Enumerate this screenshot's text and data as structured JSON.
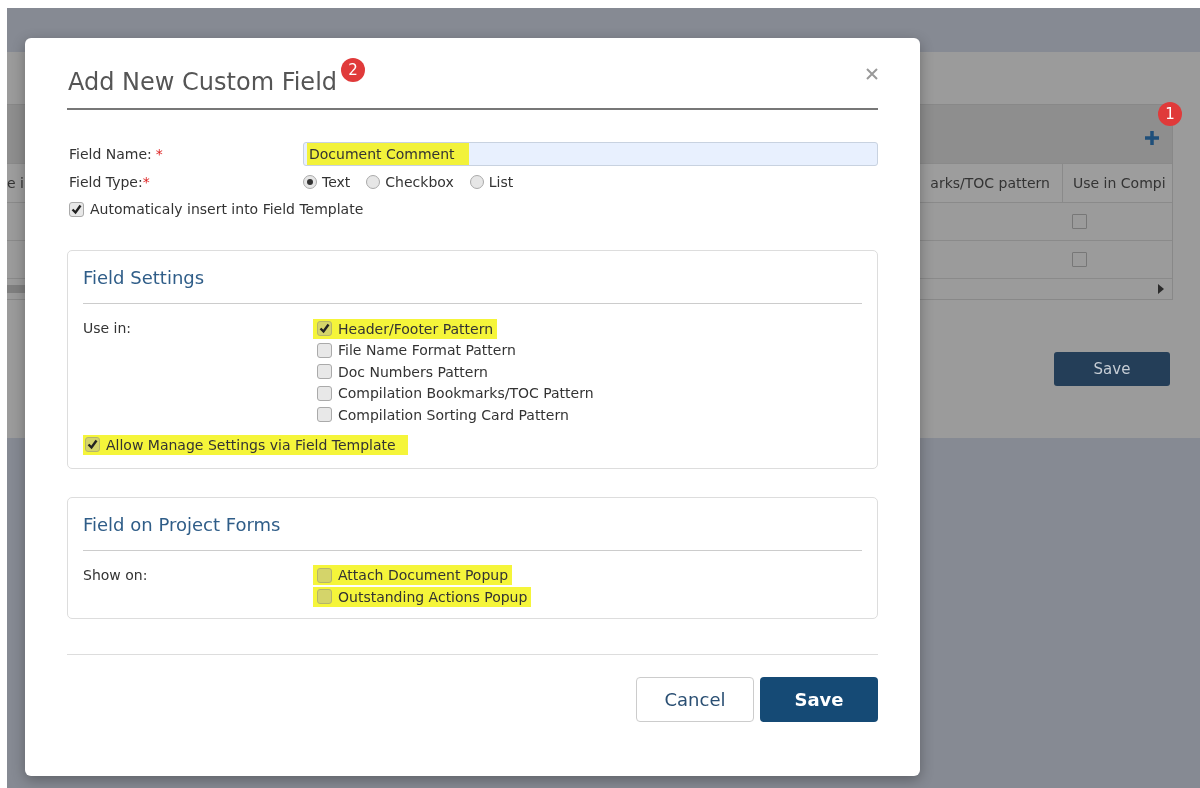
{
  "background": {
    "add_badge": "1",
    "table": {
      "columns": [
        "e i",
        "arks/TOC pattern",
        "Use in Compi"
      ],
      "rows": [
        {
          "checked": false
        },
        {
          "checked": false
        }
      ]
    },
    "save_button": "Save"
  },
  "dialog": {
    "title": "Add New Custom Field",
    "title_badge": "2",
    "fields": [
      {
        "kind": "text",
        "label": "Field Name:",
        "required_mark": "*",
        "value": "Document Comment",
        "highlighted": true
      },
      {
        "kind": "radio",
        "label": "Field Type:",
        "required_mark": "*",
        "options": [
          {
            "label": "Text",
            "selected": true
          },
          {
            "label": "Checkbox",
            "selected": false
          },
          {
            "label": "List",
            "selected": false
          }
        ]
      }
    ],
    "auto_insert": {
      "label": "Automaticaly insert into Field Template",
      "checked": true
    },
    "sections": [
      {
        "title": "Field Settings",
        "group_label": "Use in:",
        "options": [
          {
            "label": "Header/Footer Pattern",
            "checked": true,
            "highlighted": true
          },
          {
            "label": "File Name Format Pattern",
            "checked": false,
            "highlighted": false
          },
          {
            "label": "Doc Numbers Pattern",
            "checked": false,
            "highlighted": false
          },
          {
            "label": "Compilation Bookmarks/TOC Pattern",
            "checked": false,
            "highlighted": false
          },
          {
            "label": "Compilation Sorting Card Pattern",
            "checked": false,
            "highlighted": false
          }
        ],
        "footer_option": {
          "label": "Allow Manage Settings via Field Template",
          "checked": true,
          "highlighted": true
        }
      },
      {
        "title": "Field on Project Forms",
        "group_label": "Show on:",
        "options": [
          {
            "label": "Attach Document Popup",
            "checked": false,
            "highlighted": true
          },
          {
            "label": "Outstanding Actions Popup",
            "checked": false,
            "highlighted": true
          }
        ]
      }
    ],
    "buttons": [
      {
        "label": "Cancel",
        "kind": "secondary"
      },
      {
        "label": "Save",
        "kind": "primary"
      }
    ]
  }
}
